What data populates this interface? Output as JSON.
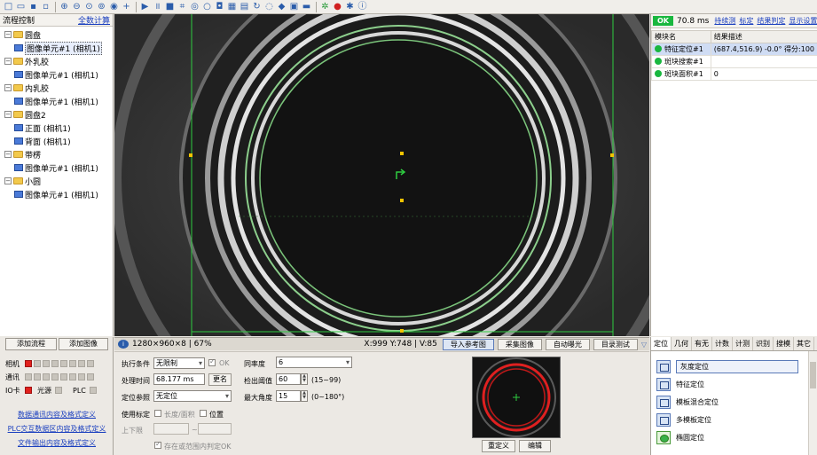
{
  "toolbar": {
    "icons": [
      "new-icon",
      "open-icon",
      "save-icon",
      "save-as-icon",
      "zoom-in-icon",
      "zoom-out-icon",
      "zoom-fit-icon",
      "zoom-reset-icon",
      "eye-icon",
      "crosshair-icon",
      "run-icon",
      "pause-icon",
      "stop-icon",
      "crop-icon",
      "ring-icon",
      "circle-icon",
      "camera-icon",
      "grid-icon",
      "image-icon",
      "rotate-icon",
      "blur-icon",
      "color-icon",
      "monitor-icon",
      "keyboard-icon",
      "gear-icon",
      "pin-icon",
      "settings-icon",
      "info-icon"
    ]
  },
  "left_panel": {
    "title": "流程控制",
    "link": "全数计算",
    "tree": [
      {
        "label": "圆盘",
        "type": "folder"
      },
      {
        "label": "图像单元#1 (相机1)",
        "type": "image",
        "selected": true
      },
      {
        "label": "外乳胶",
        "type": "folder"
      },
      {
        "label": "图像单元#1 (相机1)",
        "type": "image"
      },
      {
        "label": "内乳胶",
        "type": "folder"
      },
      {
        "label": "图像单元#1 (相机1)",
        "type": "image"
      },
      {
        "label": "圆盘2",
        "type": "folder"
      },
      {
        "label": "正面 (相机1)",
        "type": "image"
      },
      {
        "label": "背面 (相机1)",
        "type": "image"
      },
      {
        "label": "带楞",
        "type": "folder"
      },
      {
        "label": "图像单元#1 (相机1)",
        "type": "image"
      },
      {
        "label": "小圆",
        "type": "folder"
      },
      {
        "label": "图像单元#1 (相机1)",
        "type": "image"
      }
    ],
    "add_process": "添加流程",
    "add_image": "添加图像",
    "io": {
      "camera": "相机",
      "comm": "通讯",
      "io_card": "IO卡",
      "light": "光源",
      "plc": "PLC"
    },
    "links": [
      "数据通讯内容及格式定义",
      "PLC交互数据区内容及格式定义",
      "文件输出内容及格式定义"
    ]
  },
  "right_panel": {
    "status": "OK",
    "time": "70.8 ms",
    "links": [
      "持续测",
      "标定",
      "结果判定",
      "显示设置"
    ],
    "columns": [
      "模块名",
      "结果描述"
    ],
    "rows": [
      {
        "name": "特征定位#1",
        "desc": "(687.4,516.9) -0.0° 得分:100"
      },
      {
        "name": "斑块搜索#1",
        "desc": ""
      },
      {
        "name": "斑块面积#1",
        "desc": "0"
      }
    ]
  },
  "status_bar": {
    "info": "1280×960×8 | 67%",
    "coords": "X:999 Y:748 | V:85",
    "buttons": [
      "导入参考图",
      "采集图像",
      "自动曝光",
      "目录测试"
    ]
  },
  "params": {
    "exec_label": "执行条件",
    "exec_value": "无限制",
    "ok_label": "OK",
    "proc_time_label": "处理时间",
    "proc_time_value": "68.177 ms",
    "rename": "更名",
    "ref_label": "定位参照",
    "ref_value": "无定位",
    "use_cal_label": "使用标定",
    "len_area_label": "长度/面积",
    "position_label": "位置",
    "limit_label": "上下限",
    "limit_sep": "~",
    "range_ok_label": "存在或范围内判定OK",
    "similarity_label": "同率度",
    "similarity_value": "6",
    "threshold_label": "检出阈值",
    "threshold_value": "60",
    "threshold_range": "(15~99)",
    "max_angle_label": "最大角度",
    "max_angle_value": "15",
    "max_angle_range": "(0~180°)",
    "redefine": "重定义",
    "edit": "编辑"
  },
  "tools": {
    "tabs": [
      "定位",
      "几何",
      "有无",
      "计数",
      "计测",
      "识别",
      "搜模",
      "其它"
    ],
    "items": [
      "灰度定位",
      "特征定位",
      "模板混合定位",
      "多模板定位",
      "椭圆定位"
    ]
  }
}
